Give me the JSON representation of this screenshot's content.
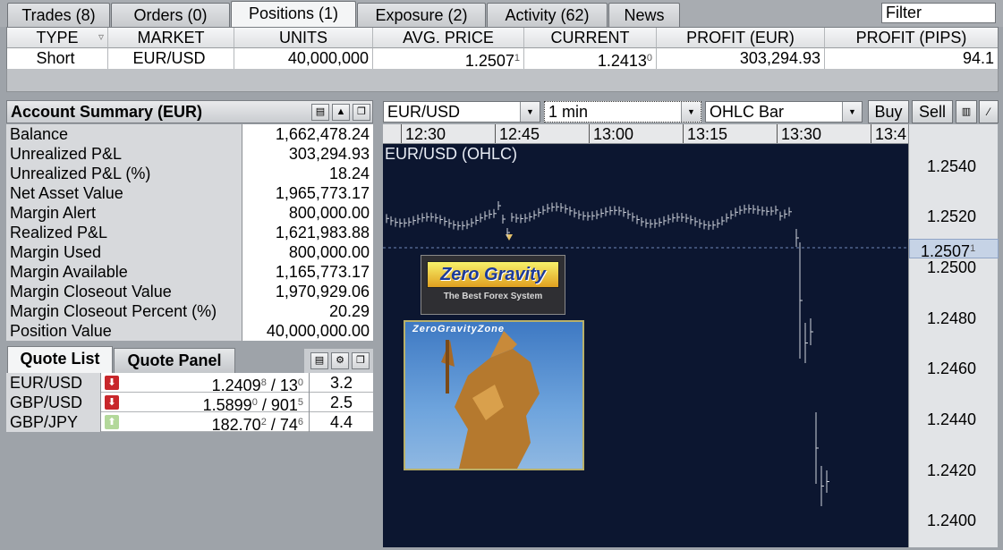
{
  "tabs": [
    {
      "label": "Trades (8)"
    },
    {
      "label": "Orders (0)"
    },
    {
      "label": "Positions (1)"
    },
    {
      "label": "Exposure (2)"
    },
    {
      "label": "Activity (62)"
    },
    {
      "label": "News"
    }
  ],
  "filter": {
    "value": "Filter"
  },
  "positions": {
    "headers": [
      "TYPE",
      "MARKET",
      "UNITS",
      "AVG. PRICE",
      "CURRENT",
      "PROFIT (EUR)",
      "PROFIT (PIPS)"
    ],
    "row": {
      "type": "Short",
      "market": "EUR/USD",
      "units": "40,000,000",
      "avg_price": "1.2507",
      "avg_price_pip": "1",
      "current": "1.2413",
      "current_pip": "0",
      "profit_eur": "303,294.93",
      "profit_pips": "94.1"
    }
  },
  "account": {
    "title": "Account Summary (EUR)",
    "rows": [
      {
        "label": "Balance",
        "value": "1,662,478.24"
      },
      {
        "label": "Unrealized P&L",
        "value": "303,294.93"
      },
      {
        "label": "Unrealized P&L (%)",
        "value": "18.24"
      },
      {
        "label": "Net Asset Value",
        "value": "1,965,773.17"
      },
      {
        "label": "Margin Alert",
        "value": "800,000.00"
      },
      {
        "label": "Realized P&L",
        "value": "1,621,983.88"
      },
      {
        "label": "Margin Used",
        "value": "800,000.00"
      },
      {
        "label": "Margin Available",
        "value": "1,165,773.17"
      },
      {
        "label": "Margin Closeout Value",
        "value": "1,970,929.06"
      },
      {
        "label": "Margin Closeout Percent (%)",
        "value": "20.29"
      },
      {
        "label": "Position Value",
        "value": "40,000,000.00"
      }
    ]
  },
  "quotes": {
    "tab_list": "Quote List",
    "tab_panel": "Quote Panel",
    "rows": [
      {
        "pair": "EUR/USD",
        "dir": "down",
        "bid": "1.2409",
        "bid_pip": "8",
        "ask": "13",
        "ask_pip": "0",
        "spread": "3.2"
      },
      {
        "pair": "GBP/USD",
        "dir": "down",
        "bid": "1.5899",
        "bid_pip": "0",
        "ask": "901",
        "ask_pip": "5",
        "spread": "2.5"
      },
      {
        "pair": "GBP/JPY",
        "dir": "up",
        "bid": "182.70",
        "bid_pip": "2",
        "ask": "74",
        "ask_pip": "6",
        "spread": "4.4"
      }
    ]
  },
  "chart_toolbar": {
    "instrument": "EUR/USD",
    "interval": "1 min",
    "style": "OHLC Bar",
    "buy_label": "Buy",
    "sell_label": "Sell"
  },
  "chart": {
    "title": "EUR/USD (OHLC)",
    "time_labels": [
      "12:30",
      "12:45",
      "13:00",
      "13:15",
      "13:30",
      "13:4"
    ],
    "price_labels": [
      "1.2540",
      "1.2520",
      "1.2500",
      "1.2480",
      "1.2460",
      "1.2440",
      "1.2420",
      "1.2400"
    ],
    "current_price": "1.2507",
    "current_price_pip": "1",
    "logo_text": "Zero Gravity",
    "logo_subtext": "The Best Forex System",
    "image_caption": "ZeroGravityZone"
  },
  "colors": {
    "chart_bg": "#0c1630",
    "bars": "#d0d4dc",
    "down_arrow": "#c8272b",
    "up_arrow": "#b3d89a"
  }
}
